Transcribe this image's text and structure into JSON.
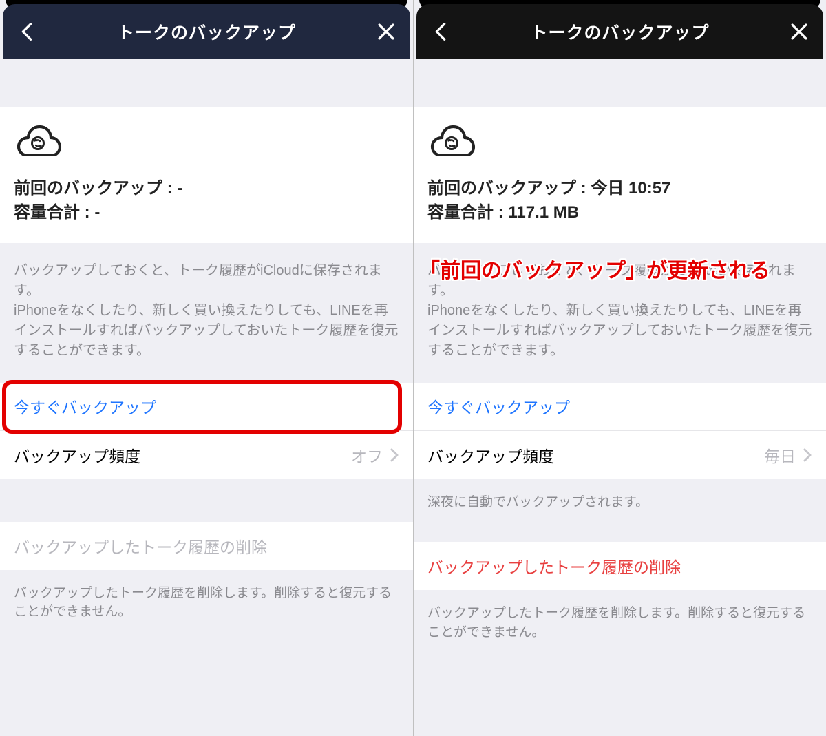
{
  "left": {
    "header": {
      "title": "トークのバックアップ"
    },
    "status": {
      "last_backup_label": "前回のバックアップ :",
      "last_backup_value": "-",
      "size_label": "容量合計 :",
      "size_value": "-"
    },
    "desc1": "バックアップしておくと、トーク履歴がiCloudに保存されます。\niPhoneをなくしたり、新しく買い換えたりしても、LINEを再インストールすればバックアップしておいたトーク履歴を復元することができます。",
    "backup_now": "今すぐバックアップ",
    "frequency_label": "バックアップ頻度",
    "frequency_value": "オフ",
    "delete_label": "バックアップしたトーク履歴の削除",
    "delete_desc": "バックアップしたトーク履歴を削除します。削除すると復元することができません。"
  },
  "right": {
    "header": {
      "title": "トークのバックアップ"
    },
    "status": {
      "last_backup_label": "前回のバックアップ :",
      "last_backup_value": "今日 10:57",
      "size_label": "容量合計 :",
      "size_value": "117.1 MB"
    },
    "desc1": "バックアップしておくと、トーク履歴がiCloudに保存されます。\niPhoneをなくしたり、新しく買い換えたりしても、LINEを再インストールすればバックアップしておいたトーク履歴を復元することができます。",
    "backup_now": "今すぐバックアップ",
    "frequency_label": "バックアップ頻度",
    "frequency_value": "毎日",
    "frequency_footer": "深夜に自動でバックアップされます。",
    "delete_label": "バックアップしたトーク履歴の削除",
    "delete_desc": "バックアップしたトーク履歴を削除します。削除すると復元することができません。",
    "annotation": "「前回のバックアップ」が更新される"
  }
}
